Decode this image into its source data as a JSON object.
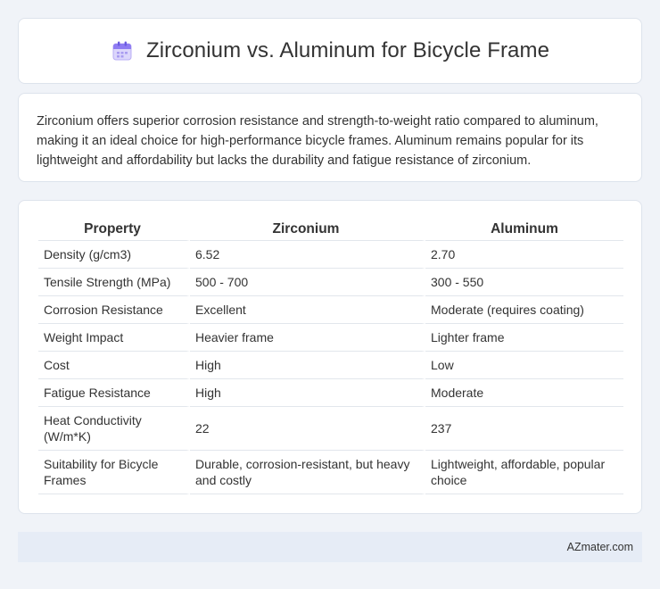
{
  "header": {
    "title": "Zirconium vs. Aluminum for Bicycle Frame",
    "icon": "calendar-icon"
  },
  "intro": {
    "text": "Zirconium offers superior corrosion resistance and strength-to-weight ratio compared to aluminum, making it an ideal choice for high-performance bicycle frames. Aluminum remains popular for its lightweight and affordability but lacks the durability and fatigue resistance of zirconium."
  },
  "table": {
    "headers": [
      "Property",
      "Zirconium",
      "Aluminum"
    ],
    "rows": [
      [
        "Density (g/cm3)",
        "6.52",
        "2.70"
      ],
      [
        "Tensile Strength (MPa)",
        "500 - 700",
        "300 - 550"
      ],
      [
        "Corrosion Resistance",
        "Excellent",
        "Moderate (requires coating)"
      ],
      [
        "Weight Impact",
        "Heavier frame",
        "Lighter frame"
      ],
      [
        "Cost",
        "High",
        "Low"
      ],
      [
        "Fatigue Resistance",
        "High",
        "Moderate"
      ],
      [
        "Heat Conductivity (W/m*K)",
        "22",
        "237"
      ],
      [
        "Suitability for Bicycle Frames",
        "Durable, corrosion-resistant, but heavy and costly",
        "Lightweight, affordable, popular choice"
      ]
    ]
  },
  "footer": {
    "brand": "AZmater.com"
  },
  "colors": {
    "background": "#f0f3f8",
    "card": "#ffffff",
    "footer": "#e6ecf6",
    "icon_accent": "#7b61ff"
  }
}
